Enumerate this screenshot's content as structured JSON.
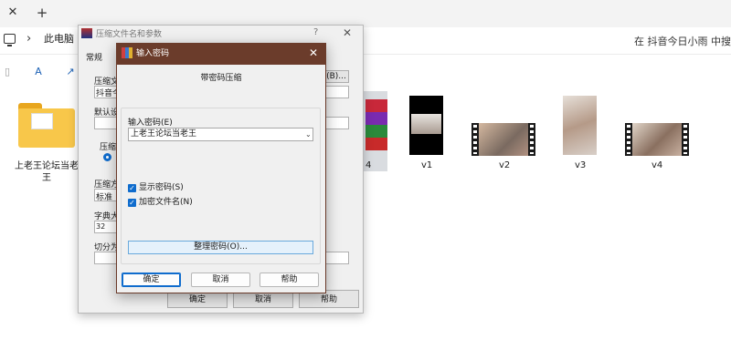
{
  "explorer": {
    "tab_close": "✕",
    "tab_new": "+",
    "crumb_sep": "›",
    "breadcrumb": "此电脑",
    "search_text": "在 抖音今日小雨 中搜索",
    "toolbar_icons": [
      "paste-icon",
      "rename-icon",
      "share-icon"
    ],
    "items": [
      {
        "label": "上老王论坛当老王",
        "type": "folder"
      },
      {
        "label": "4",
        "type": "image"
      },
      {
        "label": "v1",
        "type": "video"
      },
      {
        "label": "v2",
        "type": "video"
      },
      {
        "label": "v3",
        "type": "video"
      },
      {
        "label": "v4",
        "type": "video"
      }
    ]
  },
  "bg_dialog": {
    "title": "压缩文件名和参数",
    "help": "?",
    "close": "✕",
    "tab_general": "常规",
    "archive_label": "压缩文",
    "archive_value": "抖音今",
    "browse": "(B)...",
    "default_label": "默认设",
    "format_label": "压缩",
    "method_label": "压缩方",
    "method_value": "标准",
    "dict_label": "字典大",
    "dict_value": "32",
    "split_label": "切分为",
    "ok": "确定",
    "cancel": "取消",
    "help_btn": "帮助"
  },
  "dialog": {
    "title": "输入密码",
    "close": "✕",
    "header": "带密码压缩",
    "password_label": "输入密码(E)",
    "password_value": "上老王论坛当老王",
    "dropdown_caret": "⌄",
    "show_password": {
      "label": "显示密码(S)",
      "checked": true
    },
    "encrypt_filenames": {
      "label": "加密文件名(N)",
      "checked": true
    },
    "check_mark": "✓",
    "organize_button": "整理密码(O)...",
    "ok": "确定",
    "cancel": "取消",
    "help": "帮助"
  },
  "colors": {
    "title_bar": "#6b3c2b",
    "accent": "#0f6ccd",
    "folder": "#f8c74a"
  }
}
